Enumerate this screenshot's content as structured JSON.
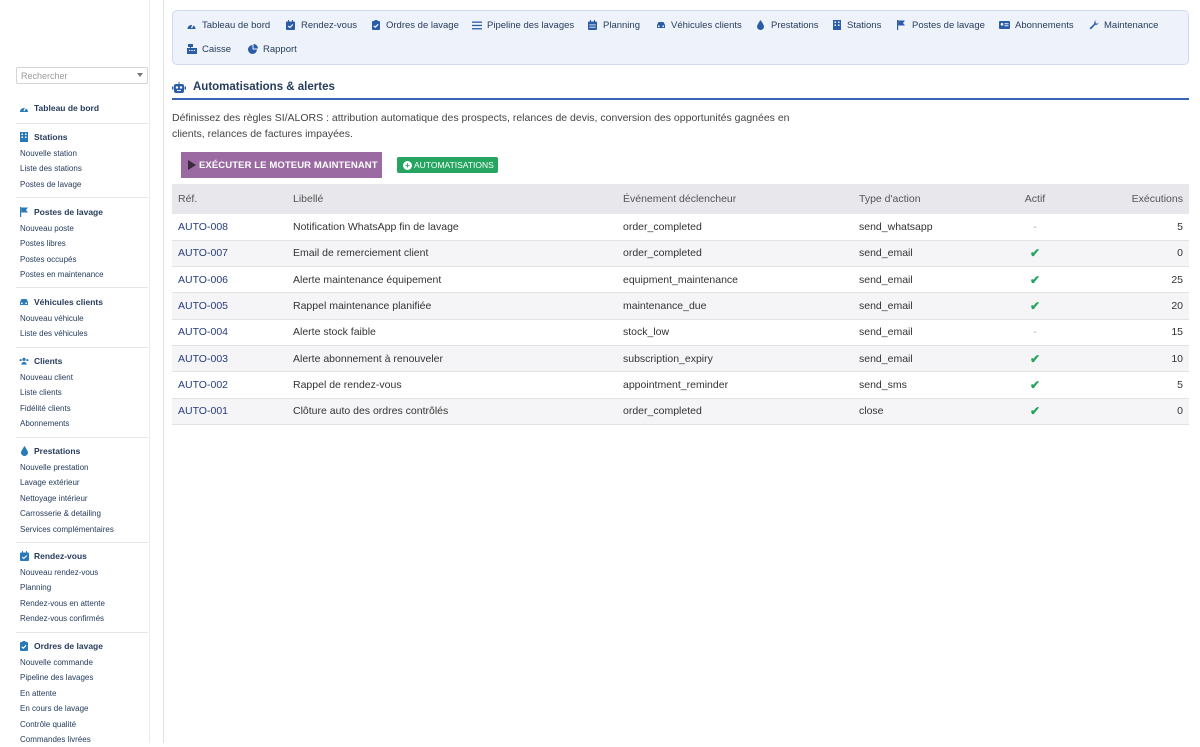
{
  "sidebar": {
    "search_placeholder": "Rechercher",
    "sections": [
      {
        "title": "Tableau de bord",
        "icon": "gauge-icon",
        "items": []
      },
      {
        "title": "Stations",
        "icon": "building-icon",
        "items": [
          "Nouvelle station",
          "Liste des stations",
          "Postes de lavage"
        ]
      },
      {
        "title": "Postes de lavage",
        "icon": "flag-icon",
        "items": [
          "Nouveau poste",
          "Postes libres",
          "Postes occupés",
          "Postes en maintenance"
        ]
      },
      {
        "title": "Véhicules clients",
        "icon": "car-icon",
        "items": [
          "Nouveau véhicule",
          "Liste des véhicules"
        ]
      },
      {
        "title": "Clients",
        "icon": "users-icon",
        "items": [
          "Nouveau client",
          "Liste clients",
          "Fidélité clients",
          "Abonnements"
        ]
      },
      {
        "title": "Prestations",
        "icon": "drop-icon",
        "items": [
          "Nouvelle prestation",
          "Lavage extérieur",
          "Nettoyage intérieur",
          "Carrosserie & detailing",
          "Services complémentaires"
        ]
      },
      {
        "title": "Rendez-vous",
        "icon": "calendar-check-icon",
        "items": [
          "Nouveau rendez-vous",
          "Planning",
          "Rendez-vous en attente",
          "Rendez-vous confirmés"
        ]
      },
      {
        "title": "Ordres de lavage",
        "icon": "clipboard-check-icon",
        "items": [
          "Nouvelle commande",
          "Pipeline des lavages",
          "En attente",
          "En cours de lavage",
          "Contrôle qualité",
          "Commandes livrées"
        ]
      }
    ]
  },
  "topnav": {
    "items": [
      {
        "label": "Tableau de bord",
        "icon": "gauge-icon"
      },
      {
        "label": "Rendez-vous",
        "icon": "calendar-check-icon"
      },
      {
        "label": "Ordres de lavage",
        "icon": "clipboard-check-icon"
      },
      {
        "label": "Pipeline des lavages",
        "icon": "bars-icon"
      },
      {
        "label": "Planning",
        "icon": "calendar-icon"
      },
      {
        "label": "Véhicules clients",
        "icon": "car-icon"
      },
      {
        "label": "Prestations",
        "icon": "drop-icon"
      },
      {
        "label": "Stations",
        "icon": "building-icon"
      },
      {
        "label": "Postes de lavage",
        "icon": "flag-icon"
      },
      {
        "label": "Abonnements",
        "icon": "id-card-icon"
      },
      {
        "label": "Maintenance",
        "icon": "wrench-icon"
      },
      {
        "label": "Caisse",
        "icon": "cash-register-icon"
      },
      {
        "label": "Rapport",
        "icon": "pie-chart-icon"
      }
    ]
  },
  "page": {
    "title": "Automatisations & alertes",
    "icon": "robot-icon",
    "description": "Définissez des règles SI/ALORS : attribution automatique des prospects, relances de devis, conversion des opportunités gagnées en clients, relances de factures impayées.",
    "run_button": "EXÉCUTER LE MOTEUR MAINTENANT",
    "auto_button": "AUTOMATISATIONS"
  },
  "table": {
    "columns": [
      "Réf.",
      "Libellé",
      "Événement déclencheur",
      "Type d'action",
      "Actif",
      "Exécutions"
    ],
    "rows": [
      {
        "ref": "AUTO-008",
        "label": "Notification WhatsApp fin de lavage",
        "event": "order_completed",
        "action": "send_whatsapp",
        "active": false,
        "runs": "5"
      },
      {
        "ref": "AUTO-007",
        "label": "Email de remerciement client",
        "event": "order_completed",
        "action": "send_email",
        "active": true,
        "runs": "0"
      },
      {
        "ref": "AUTO-006",
        "label": "Alerte maintenance équipement",
        "event": "equipment_maintenance",
        "action": "send_email",
        "active": true,
        "runs": "25"
      },
      {
        "ref": "AUTO-005",
        "label": "Rappel maintenance planifiée",
        "event": "maintenance_due",
        "action": "send_email",
        "active": true,
        "runs": "20"
      },
      {
        "ref": "AUTO-004",
        "label": "Alerte stock faible",
        "event": "stock_low",
        "action": "send_email",
        "active": false,
        "runs": "15"
      },
      {
        "ref": "AUTO-003",
        "label": "Alerte abonnement à renouveler",
        "event": "subscription_expiry",
        "action": "send_email",
        "active": true,
        "runs": "10"
      },
      {
        "ref": "AUTO-002",
        "label": "Rappel de rendez-vous",
        "event": "appointment_reminder",
        "action": "send_sms",
        "active": true,
        "runs": "5"
      },
      {
        "ref": "AUTO-001",
        "label": "Clôture auto des ordres contrôlés",
        "event": "order_completed",
        "action": "close",
        "active": true,
        "runs": "0"
      }
    ],
    "active_symbol": "✔",
    "inactive_symbol": "-"
  },
  "colors": {
    "accent": "#3b63b3",
    "run_button": "#9b6aa3",
    "auto_button": "#25a55f",
    "check": "#25a55f",
    "nav_bg": "#eef2fb"
  }
}
